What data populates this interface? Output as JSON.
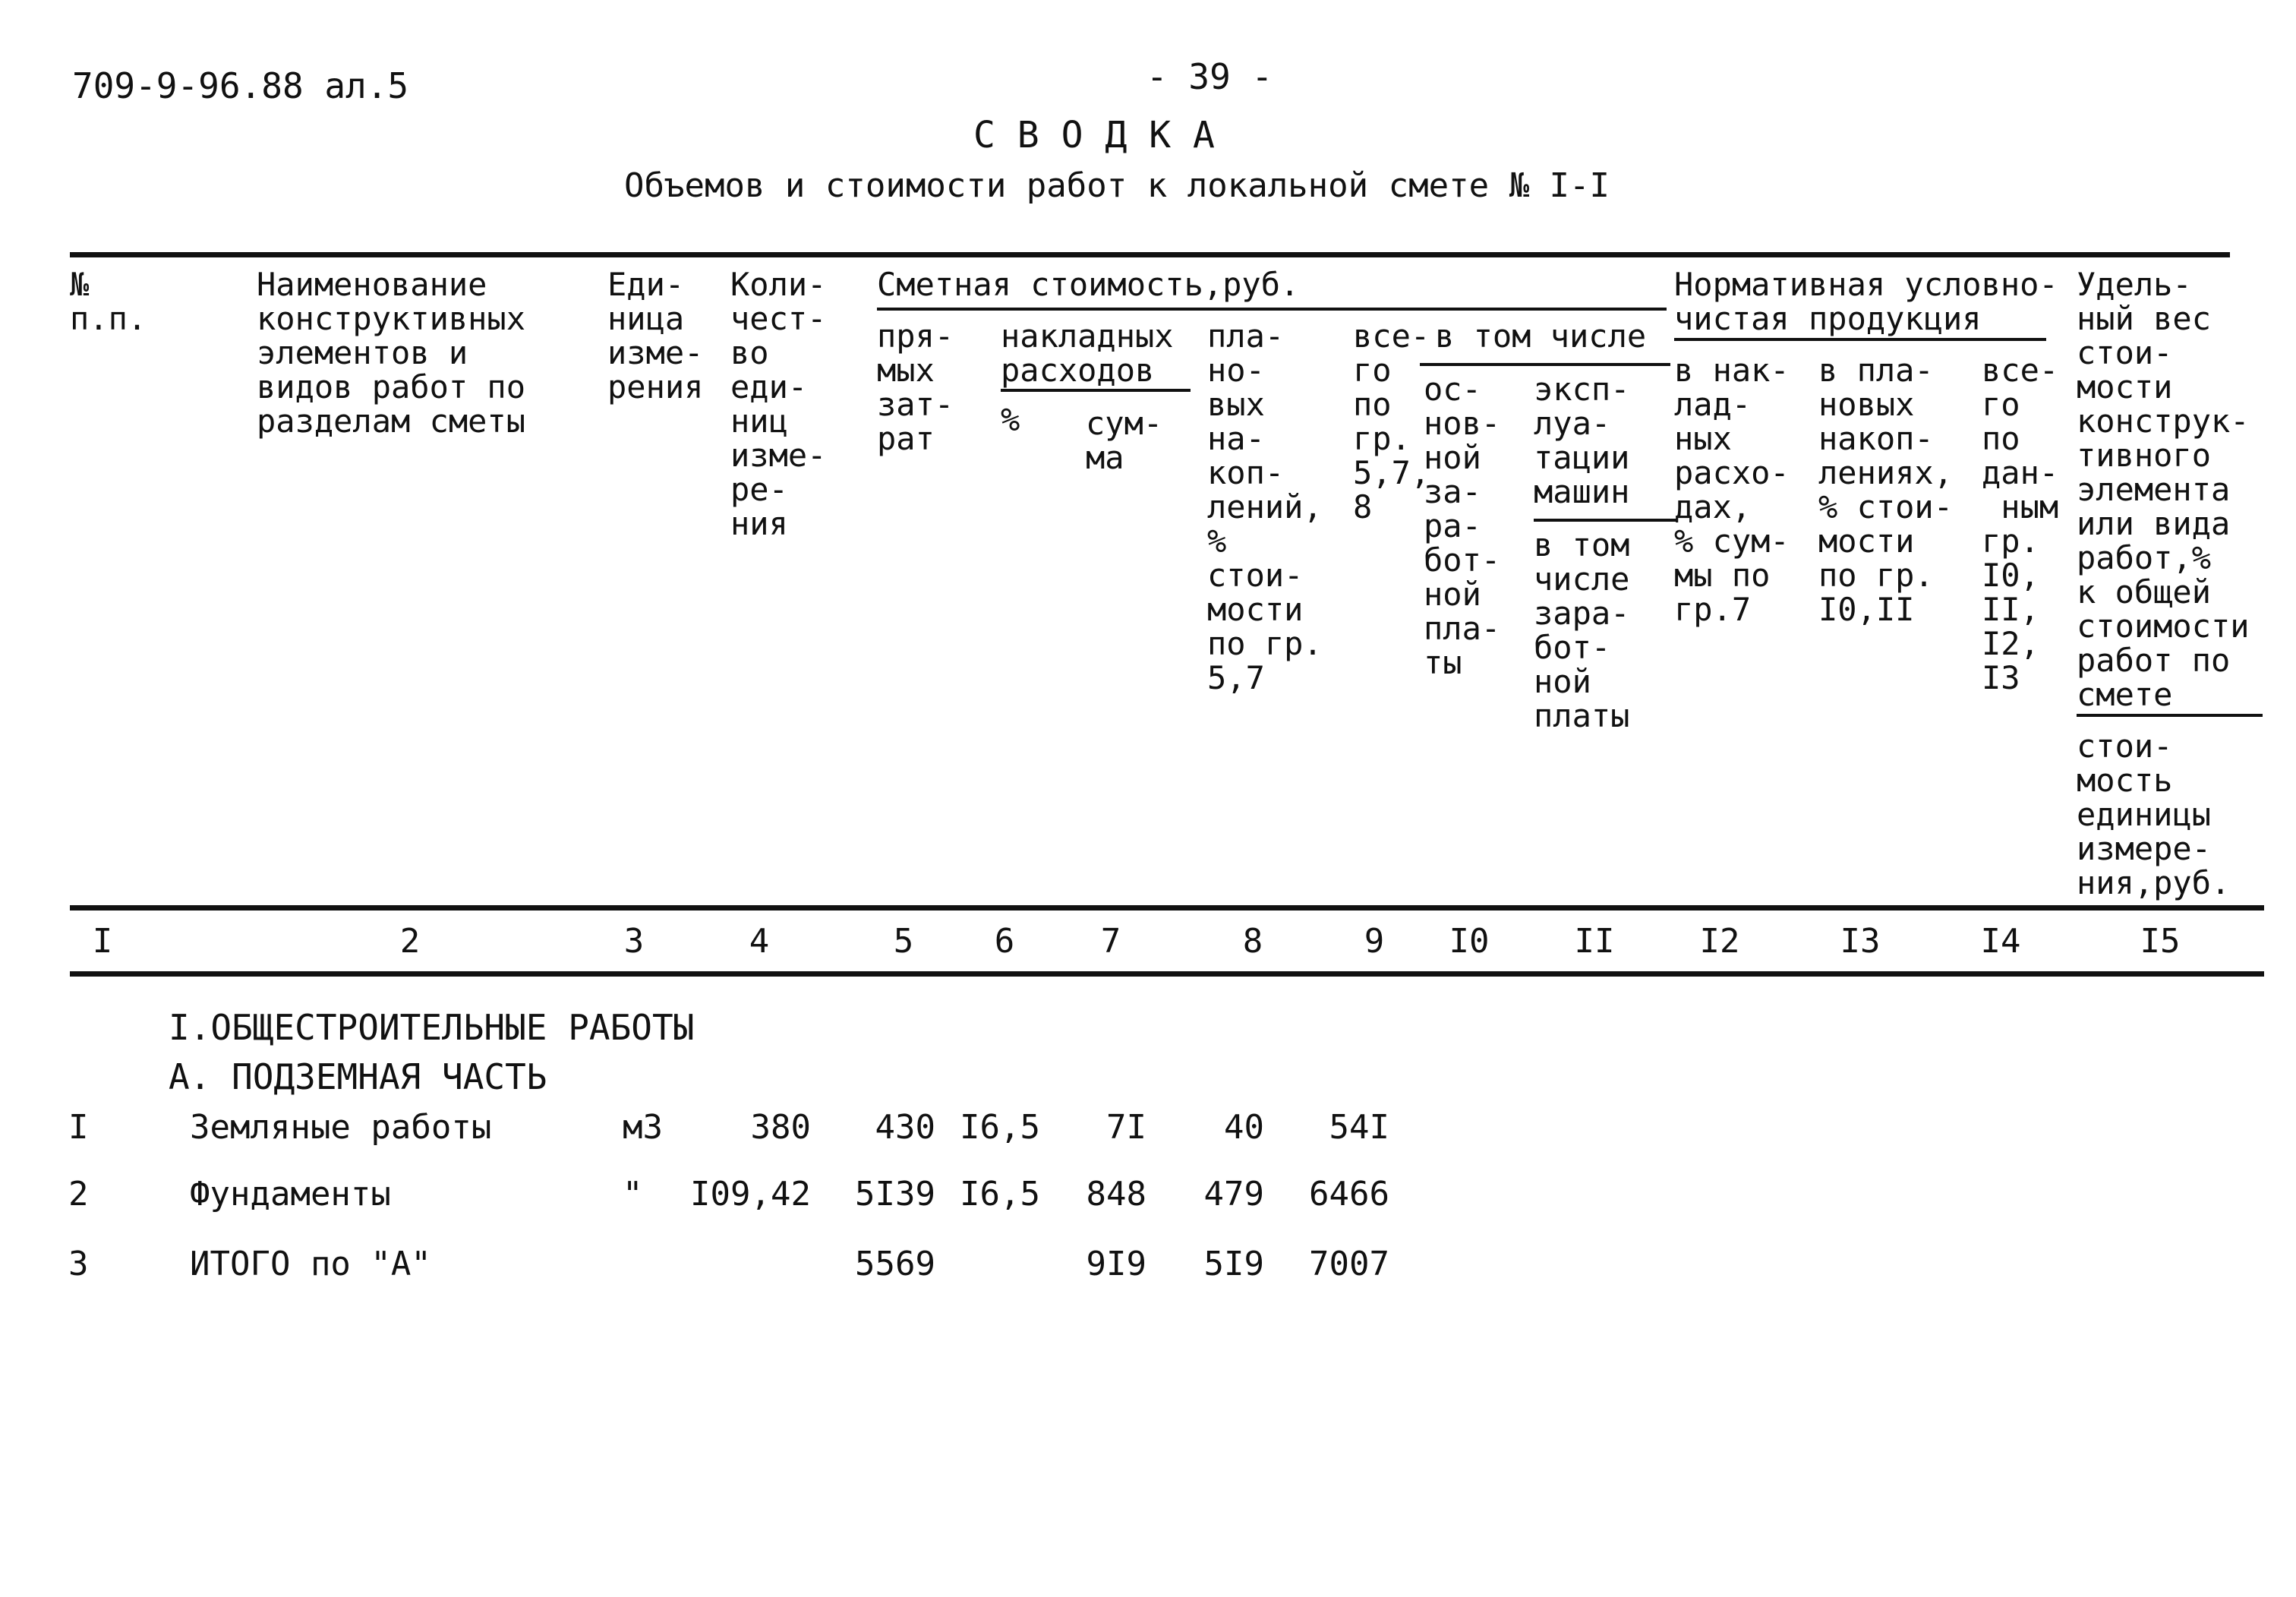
{
  "document": {
    "code": "709-9-96.88 ал.5",
    "page_number": "- 39 -",
    "title": "С В О Д К А",
    "subtitle": "Объемов и стоимости работ к локальной смете № I-I"
  },
  "table": {
    "headers": {
      "col1": "№\nп.п.",
      "col2": "Наименование\nконструктивных\nэлементов и\nвидов работ по\nразделам сметы",
      "col3": "Еди-\nница\nизме-\nрения",
      "col4": "Коли-\nчест-\nво\nеди-\nниц\nизме-\nре-\nния",
      "group_cost": "Сметная стоимость,руб.",
      "col5": "пря-\nмых\nзат-\nрат",
      "group_overhead": "накладных\nрасходов",
      "col6": "%",
      "col7": "сум-\nма",
      "col8": "пла-\nно-\nвых\nна-\nкоп-\nлений,\n%\nстои-\nмости\nпо гр.\n5,7",
      "col9": "все-\nго\nпо\nгр.\n5,7,\n8",
      "group_incl": "в том числе",
      "col10": "ос-\nнов-\nной\nза-\nра-\nбот-\nной\nпла-\nты",
      "col11a": "эксп-\nлуа-\nтации\nмашин",
      "col11b": "в том\nчисле\nзара-\nбот-\nной\nплаты",
      "group_norm": "Нормативная условно-\nчистая продукция",
      "col12": "в нак-\nлад-\nных\nрасхо-\nдах,\n% сум-\nмы по\nгр.7",
      "col13": "в пла-\nновых\nнакоп-\nлениях,\n% стои-\nмости\nпо гр.\nI0,II",
      "col14": "все-\nго\nпо\nдан-\n ным\nгр.\nI0,\nII,\nI2,\nI3",
      "col15a": "Удель-\nный вес\nстои-\nмости\nконструк-\nтивного\nэлемента\nили вида\nработ,%\nк общей\nстоимости\nработ по\nсмете",
      "col15b": "стои-\nмость\nединицы\nизмере-\nния,руб."
    },
    "column_numbers": [
      "I",
      "2",
      "3",
      "4",
      "5",
      "6",
      "7",
      "8",
      "9",
      "I0",
      "II",
      "I2",
      "I3",
      "I4",
      "I5"
    ],
    "section_title": "I.ОБЩЕСТРОИТЕЛЬНЫЕ РАБОТЫ",
    "subsection_title": "А. ПОДЗЕМНАЯ ЧАСТЬ",
    "rows": [
      {
        "no": "I",
        "name": "Земляные работы",
        "unit": "м3",
        "qty": "380",
        "direct": "430",
        "overhead_pct": "I6,5",
        "overhead_sum": "7I",
        "planned": "40",
        "total": "54I"
      },
      {
        "no": "2",
        "name": "Фундаменты",
        "unit": "\"",
        "qty": "I09,42",
        "direct": "5I39",
        "overhead_pct": "I6,5",
        "overhead_sum": "848",
        "planned": "479",
        "total": "6466"
      },
      {
        "no": "3",
        "name": "ИТОГО по \"А\"",
        "unit": "",
        "qty": "",
        "direct": "5569",
        "overhead_pct": "",
        "overhead_sum": "9I9",
        "planned": "5I9",
        "total": "7007"
      }
    ]
  }
}
